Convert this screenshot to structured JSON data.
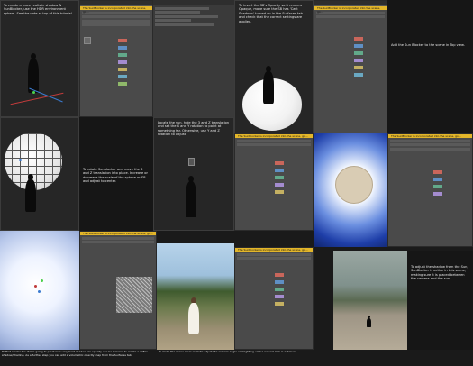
{
  "notes": {
    "n1": "To create a more realistic shadow & SunBlocker, use the HDR environment sphere. See the note at top of this tutorial.",
    "n2": "To invert the SB's Opacity so it renders Opaque, make sure the SB has 'Cast Shadows' turned on in the Surfaces tab and check that the correct settings are applied.",
    "n3": "Go ahead and use the new SunBlocker to block the Sun and set the render settings as shown.",
    "n4": "Add the Sun Blocker to the scene in Top view.",
    "n5": "To rotate Sunblocker and move the 3 and Z translation into place. Increase or decrease the scale of the sphere or SB and adjust to center.",
    "n6": "Locate the sun, hide the 3 and Z translation and set the X and Y rotation to point at something far. Otherwise, use Y and Z rotation to adjust.",
    "n7": "Once the scene is rendered the glow from the sun is blocked and the figure is correctly shaded.",
    "n8": "To first render the dial is going to produce a very hard shadow. An opacity can be lowered to create a softer shadow/shading. As a further step you can add a volumetric opacity map from the Surfaces tab.",
    "n9": "To make the scene more realistic adjust the camera angle and lighting until a natural look is achieved.",
    "n10": "To adjust the shadow from the Sun, SunBlocker is active in this scene, making sure it is placed between the camera and the sun."
  },
  "ui": {
    "banner": "The SunBlocker is incorporated into the scene, go...",
    "tabs": [
      "Surfaces",
      "Scene",
      "Parameters"
    ]
  },
  "colors": {
    "accent": "#e3b62a",
    "swatches": [
      "#c9665b",
      "#5f8fc4",
      "#62a98a",
      "#a48ccf",
      "#c4b062",
      "#6aa8c2",
      "#8fb86a"
    ]
  }
}
